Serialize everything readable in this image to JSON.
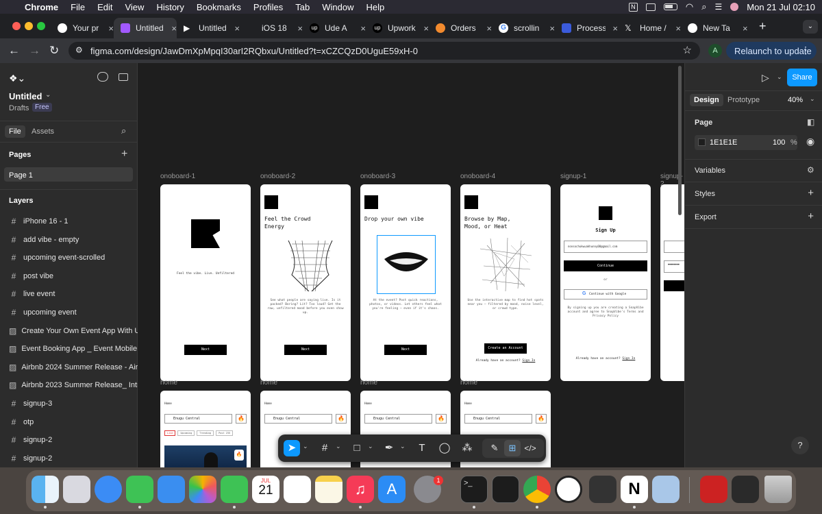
{
  "menubar": {
    "apple": "",
    "app": "Chrome",
    "items": [
      "File",
      "Edit",
      "View",
      "History",
      "Bookmarks",
      "Profiles",
      "Tab",
      "Window",
      "Help"
    ],
    "clock": "Mon 21 Jul  02:10"
  },
  "tabs": [
    {
      "title": "Your pr",
      "color": "#ffffff"
    },
    {
      "title": "Untitled",
      "color": "#a259ff"
    },
    {
      "title": "Untitled",
      "color": "#000000"
    },
    {
      "title": "iOS 18",
      "color": "#ffffff"
    },
    {
      "title": "Ude A",
      "color": "#000000"
    },
    {
      "title": "Upwork",
      "color": "#000000"
    },
    {
      "title": "Orders",
      "color": "#f28a2e"
    },
    {
      "title": "scrollin",
      "color": "#ffffff"
    },
    {
      "title": "Process",
      "color": "#3b5bdb"
    },
    {
      "title": "Home /",
      "color": "#000000"
    },
    {
      "title": "New Ta",
      "color": "#ffffff"
    }
  ],
  "address": {
    "url": "figma.com/design/JawDmXpMpqI30arI2RQbxu/Untitled?t=xCZCQzD0UguE59xH-0",
    "profile_letter": "A",
    "relaunch": "Relaunch to update"
  },
  "file": {
    "name": "Untitled",
    "location": "Drafts",
    "plan": "Free",
    "tab_file": "File",
    "tab_assets": "Assets",
    "pages_heading": "Pages",
    "page": "Page 1",
    "layers_heading": "Layers"
  },
  "layers": [
    {
      "name": "iPhone 16 - 1",
      "icon": "#"
    },
    {
      "name": "add vibe - empty",
      "icon": "#"
    },
    {
      "name": "upcoming event-scrolled",
      "icon": "#"
    },
    {
      "name": "post vibe",
      "icon": "#"
    },
    {
      "name": "live event",
      "icon": "#"
    },
    {
      "name": "upcoming event",
      "icon": "#"
    },
    {
      "name": "Create Your Own Event App With Us! 1",
      "icon": "▨"
    },
    {
      "name": "Event Booking App _ Event Mobile App",
      "icon": "▨"
    },
    {
      "name": "Airbnb 2024 Summer Release - Airbnb",
      "icon": "▨"
    },
    {
      "name": "Airbnb 2023 Summer Release_ Introdu",
      "icon": "▨"
    },
    {
      "name": "signup-3",
      "icon": "#"
    },
    {
      "name": "otp",
      "icon": "#"
    },
    {
      "name": "signup-2",
      "icon": "#"
    },
    {
      "name": "signup-2",
      "icon": "#"
    }
  ],
  "frames": {
    "labels": [
      "onoboard-1",
      "onoboard-2",
      "onoboard-3",
      "onoboard-4",
      "signup-1",
      "signup-2"
    ],
    "home_labels": [
      "home",
      "home",
      "home",
      "home"
    ],
    "tagline": "Feel the vibe. Live. Unfiltered",
    "ob2_title": "Feel the Crowd Energy",
    "ob2_body": "See what people are saying live. Is it packed? Boring? Lit? Too loud? Get the raw, unfiltered mood before you even show up.",
    "ob3_title": "Drop your own vibe",
    "ob3_body": "At the event? Post quick reactions, photos, or videos. Let others feel what you're feeling — even if it's chaos.",
    "ob4_title": "Browse by Map, Mood, or Heat",
    "ob4_body": "Use the interactive map to find hot spots near you — filtered by mood, noise level, or crowd type.",
    "next": "Next",
    "create_account": "Create an Account",
    "already": "Already have an account?",
    "sign_in": "Sign In",
    "signup_title": "Sign Up",
    "email": "nonsochukwuakhunny00@gmail.com",
    "continue": "Continue",
    "or": "or",
    "google": "Continue with Google",
    "terms": "By signing up you are creating a SnapVibe account and agree to SnapVibe's Terms and Privacy Policy",
    "home_title": "Home",
    "location": "Enugu Central",
    "chips": [
      "Live",
      "Upcoming",
      "Trending",
      "Post 235"
    ]
  },
  "rightpanel": {
    "tab_design": "Design",
    "tab_prototype": "Prototype",
    "zoom": "40%",
    "share": "Share",
    "page_heading": "Page",
    "page_color": "1E1E1E",
    "opacity": "100",
    "percent": "%",
    "variables": "Variables",
    "styles": "Styles",
    "export": "Export",
    "help": "?"
  },
  "dock": {
    "calendar_month": "JUL",
    "calendar_day": "21",
    "badge": "1"
  },
  "colors": {
    "figma_bg": "#2c2c2c",
    "canvas_bg": "#1e1e1e",
    "accent": "#0d99ff"
  }
}
